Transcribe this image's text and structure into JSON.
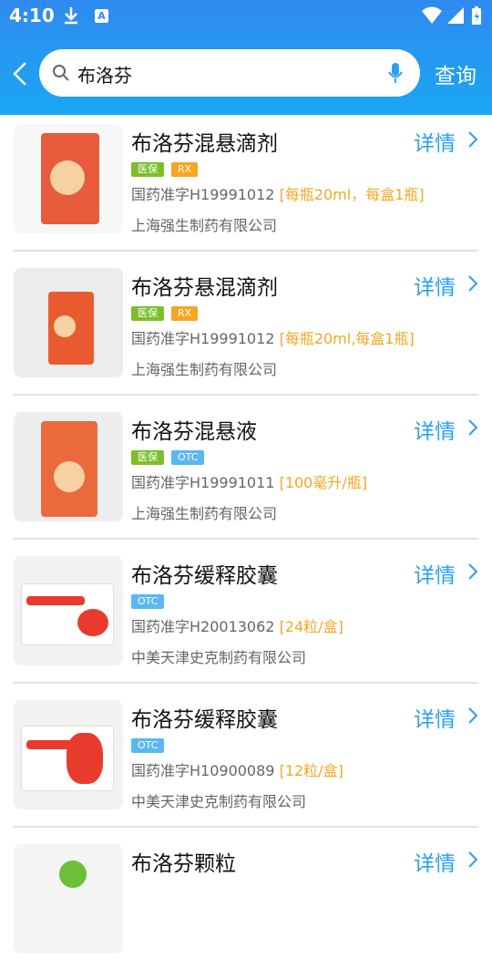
{
  "status_bar": {
    "time": "4:10"
  },
  "search": {
    "query": "布洛芬",
    "submit_label": "查询"
  },
  "detail_label": "详情",
  "items": [
    {
      "title": "布洛芬混悬滴剂",
      "tags": [
        "医保",
        "RX"
      ],
      "approval": "国药准字H19991012",
      "spec": "[每瓶20ml，每盒1瓶]",
      "maker": "上海强生制药有限公司"
    },
    {
      "title": "布洛芬悬混滴剂",
      "tags": [
        "医保",
        "RX"
      ],
      "approval": "国药准字H19991012",
      "spec": "[每瓶20ml,每盒1瓶]",
      "maker": "上海强生制药有限公司"
    },
    {
      "title": "布洛芬混悬液",
      "tags": [
        "医保",
        "OTC"
      ],
      "approval": "国药准字H19991011",
      "spec": "[100毫升/瓶]",
      "maker": "上海强生制药有限公司"
    },
    {
      "title": "布洛芬缓释胶囊",
      "tags": [
        "OTC"
      ],
      "approval": "国药准字H20013062",
      "spec": "[24粒/盒]",
      "maker": "中美天津史克制药有限公司"
    },
    {
      "title": "布洛芬缓释胶囊",
      "tags": [
        "OTC"
      ],
      "approval": "国药准字H10900089",
      "spec": "[12粒/盒]",
      "maker": "中美天津史克制药有限公司"
    },
    {
      "title": "布洛芬颗粒",
      "tags": [],
      "approval": "",
      "spec": "",
      "maker": ""
    }
  ],
  "icons": {
    "back": "chevron-left-icon",
    "search": "search-icon",
    "mic": "microphone-icon",
    "detail": "chevron-right-icon"
  },
  "colors": {
    "header_top": "#2f8af0",
    "accent": "#2aa0f0",
    "spec": "#f5a623",
    "tag_yibao": "#7cbf2a",
    "tag_rx": "#f5a623",
    "tag_otc": "#5ab8f0"
  }
}
